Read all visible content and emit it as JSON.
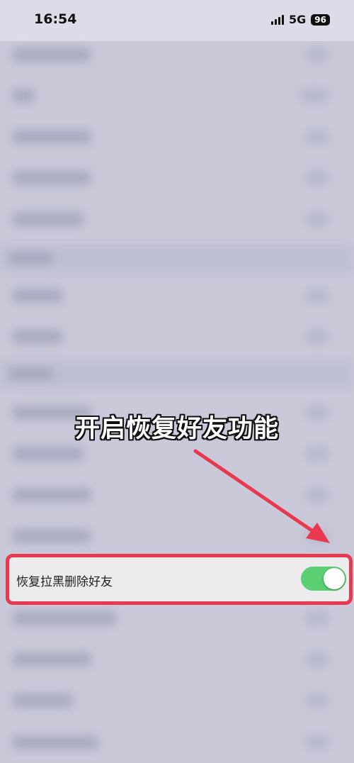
{
  "status_bar": {
    "time": "16:54",
    "network": "5G",
    "battery": "96"
  },
  "caption": "开启恢复好友功能",
  "setting": {
    "label": "恢复拉黑删除好友",
    "toggle_on": true
  },
  "colors": {
    "highlight_border": "#e8394f",
    "arrow": "#e8394f",
    "toggle_on": "#5ccf72"
  },
  "icons": [
    "signal-icon",
    "battery-icon",
    "arrow-icon"
  ]
}
